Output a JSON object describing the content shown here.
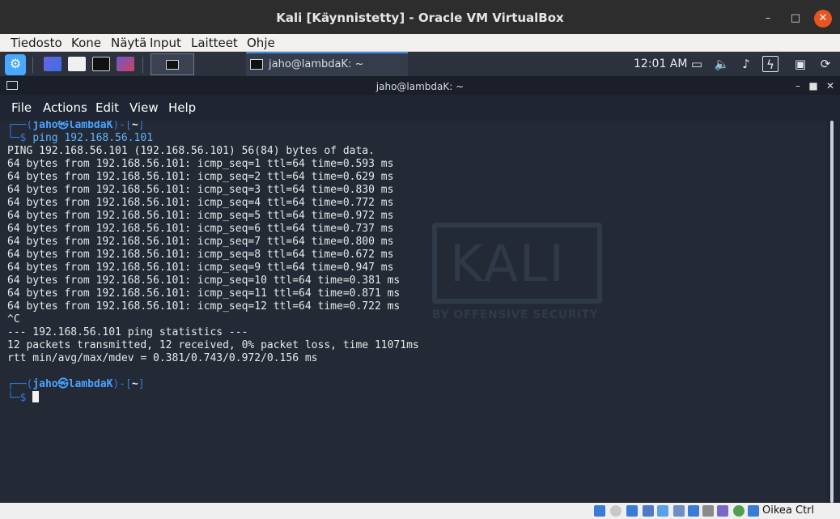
{
  "window": {
    "title": "Kali [Käynnistetty] - Oracle VM VirtualBox",
    "minimize": "–",
    "maximize": "□",
    "close": "✕"
  },
  "vbox_menu": [
    "Tiedosto",
    "Kone",
    "Näytä",
    "Input",
    "Laitteet",
    "Ohje"
  ],
  "panel": {
    "task_label": "jaho@lambdaK: ~",
    "clock": "12:01 AM",
    "tray_icons": [
      "display-icon",
      "volume-icon",
      "notification-bell-icon",
      "battery-charging-icon",
      "lock-icon",
      "logout-icon"
    ]
  },
  "terminal": {
    "title": "jaho@lambdaK: ~",
    "menu": [
      "File",
      "Actions",
      "Edit",
      "View",
      "Help"
    ],
    "prompt_user": "jaho㉿lambdaK",
    "prompt_dir": "~",
    "command": "ping 192.168.56.101",
    "output": [
      "PING 192.168.56.101 (192.168.56.101) 56(84) bytes of data.",
      "64 bytes from 192.168.56.101: icmp_seq=1 ttl=64 time=0.593 ms",
      "64 bytes from 192.168.56.101: icmp_seq=2 ttl=64 time=0.629 ms",
      "64 bytes from 192.168.56.101: icmp_seq=3 ttl=64 time=0.830 ms",
      "64 bytes from 192.168.56.101: icmp_seq=4 ttl=64 time=0.772 ms",
      "64 bytes from 192.168.56.101: icmp_seq=5 ttl=64 time=0.972 ms",
      "64 bytes from 192.168.56.101: icmp_seq=6 ttl=64 time=0.737 ms",
      "64 bytes from 192.168.56.101: icmp_seq=7 ttl=64 time=0.800 ms",
      "64 bytes from 192.168.56.101: icmp_seq=8 ttl=64 time=0.672 ms",
      "64 bytes from 192.168.56.101: icmp_seq=9 ttl=64 time=0.947 ms",
      "64 bytes from 192.168.56.101: icmp_seq=10 ttl=64 time=0.381 ms",
      "64 bytes from 192.168.56.101: icmp_seq=11 ttl=64 time=0.871 ms",
      "64 bytes from 192.168.56.101: icmp_seq=12 ttl=64 time=0.722 ms",
      "^C",
      "--- 192.168.56.101 ping statistics ---",
      "12 packets transmitted, 12 received, 0% packet loss, time 11071ms",
      "rtt min/avg/max/mdev = 0.381/0.743/0.972/0.156 ms"
    ],
    "watermark_logo": "KALI",
    "watermark_sub": "BY OFFENSIVE SECURITY"
  },
  "statusbar": {
    "host_key": "Oikea Ctrl"
  },
  "colors": {
    "terminal_bg": "#232a36",
    "prompt_blue": "#2f7bd8",
    "panel_bg": "#2b313d",
    "close_orange": "#e95420"
  }
}
